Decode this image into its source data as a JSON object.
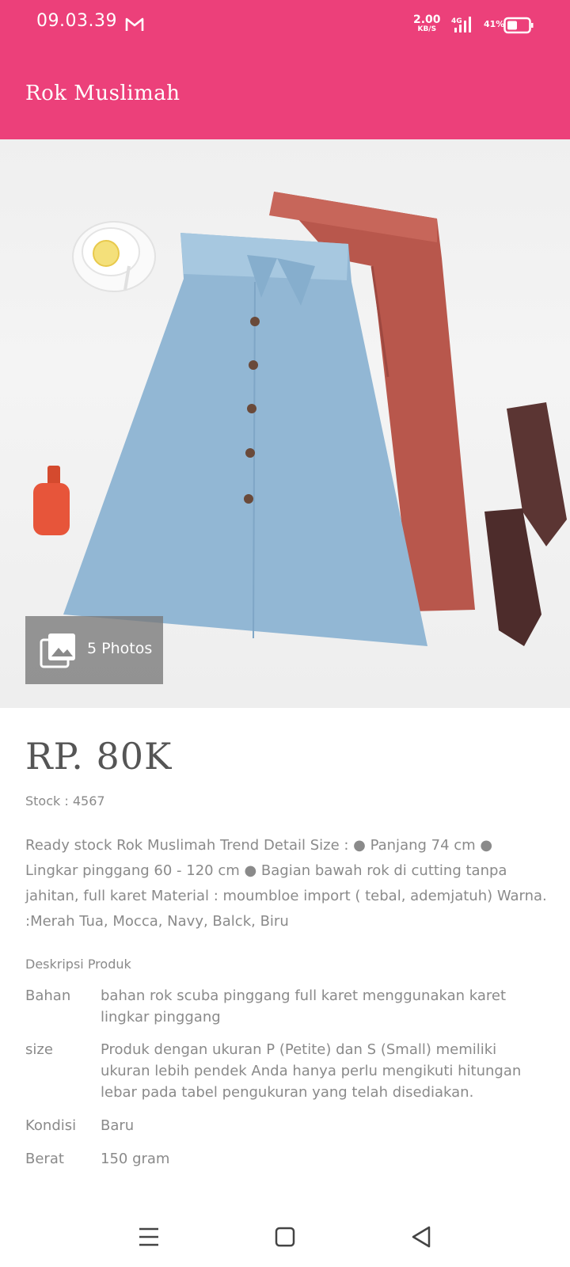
{
  "status_bar": {
    "time": "09.03.39",
    "speed_value": "2.00",
    "speed_unit": "KB/S",
    "network": "4G",
    "battery": "41%"
  },
  "header": {
    "title": "Rok Muslimah"
  },
  "gallery": {
    "photos_label": "5 Photos"
  },
  "product": {
    "price": "RP. 80K",
    "stock": "Stock : 4567",
    "description": "Ready stock Rok Muslimah Trend Detail Size : ● Panjang 74 cm ● Lingkar pinggang 60 - 120 cm ● Bagian bawah rok di cutting tanpa jahitan, full karet Material : moumbloe import ( tebal, ademjatuh) Warna. :Merah Tua, Mocca, Navy, Balck, Biru",
    "section_title": "Deskripsi Produk",
    "specs": [
      {
        "label": "Bahan",
        "value": "bahan rok scuba pinggang full karet menggunakan karet lingkar pinggang"
      },
      {
        "label": "size",
        "value": "Produk dengan ukuran P (Petite) dan S (Small) memiliki ukuran lebih pendek Anda hanya perlu mengikuti hitungan lebar pada tabel pengukuran yang telah disediakan."
      },
      {
        "label": "Kondisi",
        "value": "Baru"
      },
      {
        "label": "Berat",
        "value": "150 gram"
      }
    ]
  },
  "icons": [
    "gmail-icon",
    "signal-icon",
    "battery-icon",
    "photos-icon",
    "menu-icon",
    "home-icon",
    "back-icon"
  ],
  "colors": {
    "header": "#ec407a",
    "text": "#8a8a8a"
  }
}
